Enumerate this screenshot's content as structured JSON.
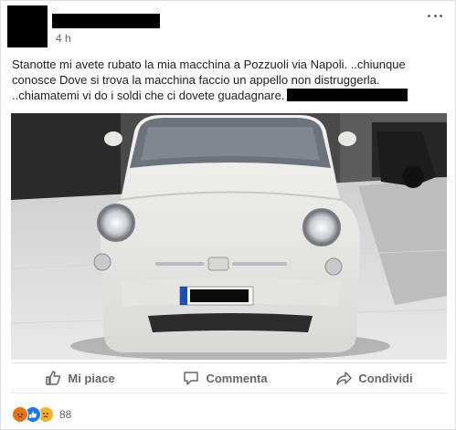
{
  "post": {
    "time": "4 h",
    "text_line1": "Stanotte mi avete rubato la mia macchina a Pozzuoli via Napoli. ..chiunque",
    "text_line2": "conosce Dove si trova la macchina faccio un appello non distruggerla.",
    "text_line3": "..chiamatemi vi do i soldi che ci dovete guadagnare."
  },
  "actions": {
    "like": "Mi piace",
    "comment": "Commenta",
    "share": "Condividi"
  },
  "reactions": {
    "types": [
      "angry",
      "like",
      "sad"
    ],
    "count": "88"
  },
  "colors": {
    "facebook_blue": "#1877f2",
    "action_gray": "#606770"
  }
}
